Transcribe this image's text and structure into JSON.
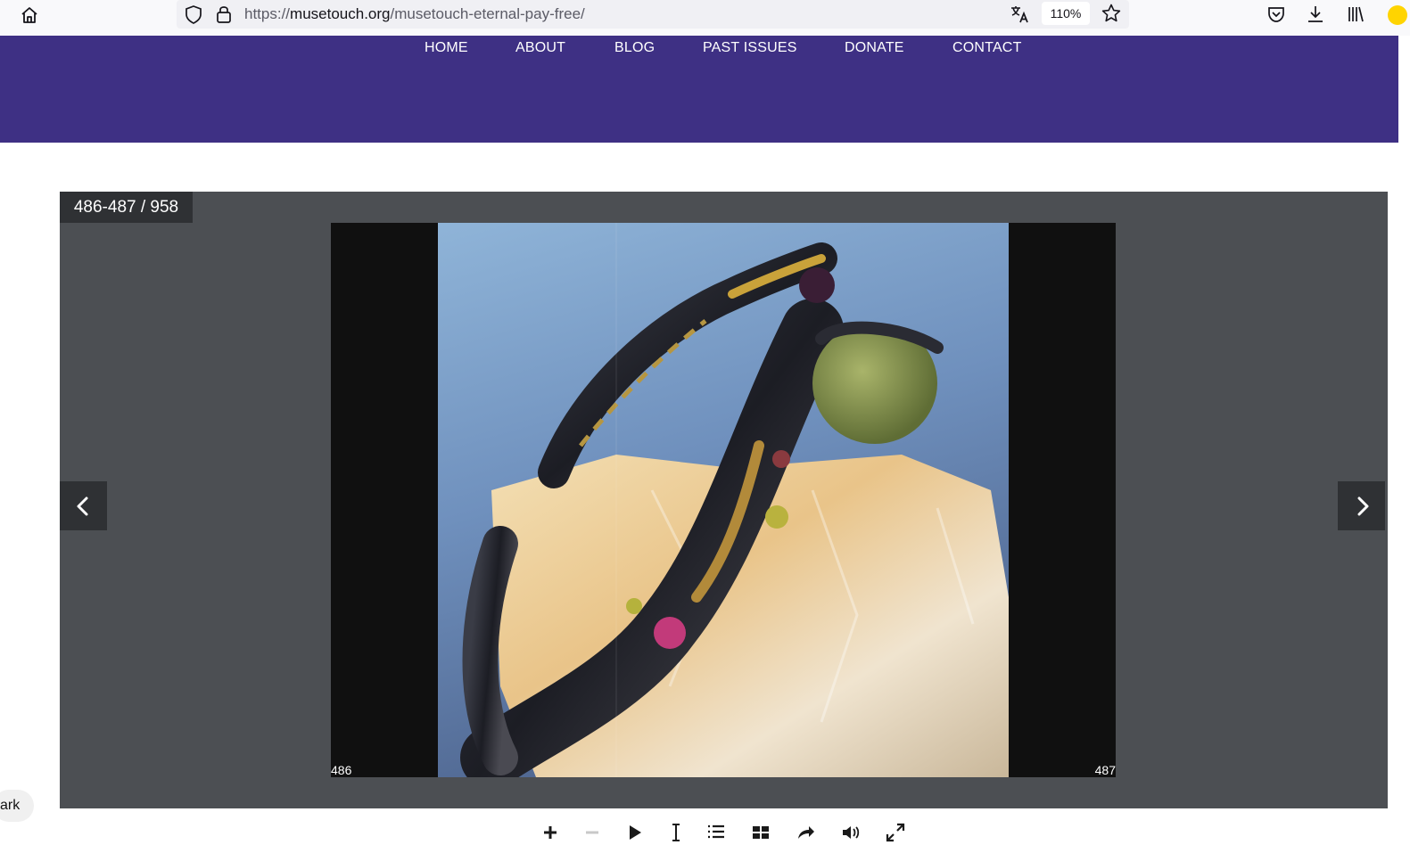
{
  "browser": {
    "url_prefix": "https://",
    "url_domain": "musetouch.org",
    "url_path": "/musetouch-eternal-pay-free/",
    "zoom": "110%"
  },
  "nav": {
    "items": [
      "HOME",
      "ABOUT",
      "BLOG",
      "PAST ISSUES",
      "DONATE",
      "CONTACT"
    ]
  },
  "flipbook": {
    "counter": "486-487 / 958",
    "left_page": "486",
    "right_page": "487"
  },
  "toolbar": {
    "icons": [
      "zoom-in-icon",
      "zoom-out-icon",
      "play-icon",
      "text-select-icon",
      "table-of-contents-icon",
      "thumbnails-icon",
      "share-icon",
      "sound-icon",
      "fullscreen-icon"
    ]
  },
  "widgets": {
    "dark_toggle": "ark"
  },
  "colors": {
    "nav_bg": "#3e3084",
    "viewer_bg": "#4c4f53",
    "viewer_dark": "#2f3134"
  }
}
